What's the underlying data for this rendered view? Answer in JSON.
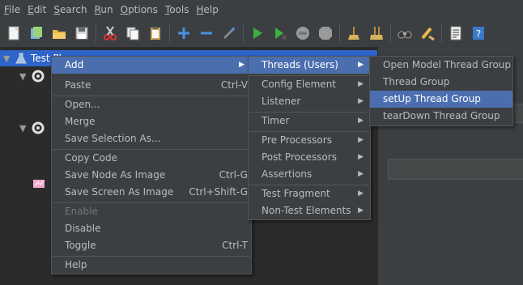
{
  "menubar": {
    "items": [
      {
        "label": "File",
        "mnemonic": "F",
        "rest": "ile"
      },
      {
        "label": "Edit",
        "mnemonic": "E",
        "rest": "dit"
      },
      {
        "label": "Search",
        "mnemonic": "S",
        "rest": "earch"
      },
      {
        "label": "Run",
        "mnemonic": "R",
        "rest": "un"
      },
      {
        "label": "Options",
        "mnemonic": "O",
        "rest": "ptions"
      },
      {
        "label": "Tools",
        "mnemonic": "T",
        "rest": "ools"
      },
      {
        "label": "Help",
        "mnemonic": "H",
        "rest": "elp"
      }
    ]
  },
  "toolbar": {
    "icons": [
      "new-icon",
      "templates-icon",
      "open-icon",
      "save-icon",
      "cut-icon",
      "copy-icon",
      "paste-icon",
      "expand-icon",
      "collapse-icon",
      "toggle-icon",
      "start-icon",
      "start-no-pause-icon",
      "stop-icon",
      "shutdown-icon",
      "clear-icon",
      "clear-all-icon",
      "search-icon",
      "reset-search-icon",
      "function-helper-icon",
      "help-icon"
    ]
  },
  "tree": {
    "root_label": "Test Plan"
  },
  "context_menu": {
    "add": "Add",
    "paste": "Paste",
    "paste_acc": "Ctrl-V",
    "open": "Open...",
    "merge": "Merge",
    "save_selection": "Save Selection As...",
    "copy_code": "Copy Code",
    "save_node_image": "Save Node As Image",
    "save_node_image_acc": "Ctrl-G",
    "save_screen_image": "Save Screen As Image",
    "save_screen_image_acc": "Ctrl+Shift-G",
    "enable": "Enable",
    "disable": "Disable",
    "toggle": "Toggle",
    "toggle_acc": "Ctrl-T",
    "help": "Help"
  },
  "add_menu": {
    "threads": "Threads (Users)",
    "config_element": "Config Element",
    "listener": "Listener",
    "timer": "Timer",
    "pre_processors": "Pre Processors",
    "post_processors": "Post Processors",
    "assertions": "Assertions",
    "test_fragment": "Test Fragment",
    "non_test_elements": "Non-Test Elements"
  },
  "threads_menu": {
    "open_model": "Open Model Thread Group",
    "thread_group": "Thread Group",
    "setup": "setUp Thread Group",
    "teardown": "tearDown Thread Group"
  },
  "colors": {
    "background": "#3c3f41",
    "tree_background": "#2b2b2b",
    "selection": "#4b6eaf",
    "text": "#bbbbbb",
    "disabled_text": "#777777"
  }
}
